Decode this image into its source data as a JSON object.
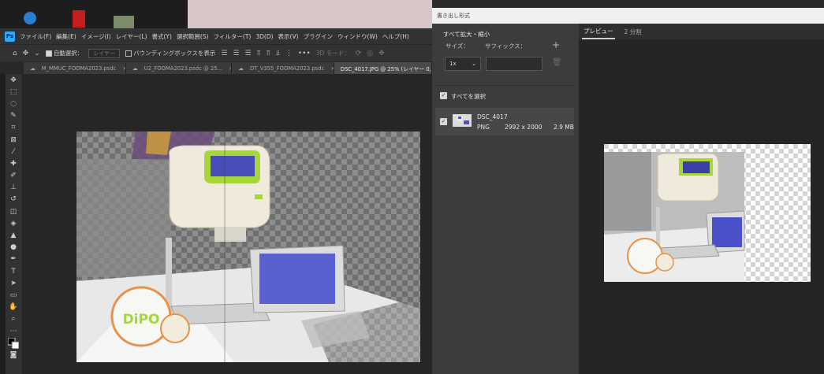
{
  "ps": {
    "logo": "Ps",
    "menu": [
      "ファイル(F)",
      "編集(E)",
      "イメージ(I)",
      "レイヤー(L)",
      "書式(Y)",
      "選択範囲(S)",
      "フィルター(T)",
      "3D(D)",
      "表示(V)",
      "プラグイン",
      "ウィンドウ(W)",
      "ヘルプ(H)"
    ],
    "options": {
      "auto_select_label": "自動選択：",
      "auto_select_value": "レイヤー",
      "bounding_box_label": "バウンディングボックスを表示",
      "mode_3d": "3D モード："
    },
    "tabs": [
      {
        "label": "M_MMUC_FOOMA2023.psdc",
        "active": false
      },
      {
        "label": "U2_FOOMA2023.psdc @ 25...",
        "active": false
      },
      {
        "label": "DT_V355_FOOMA2023.psdc",
        "active": false
      },
      {
        "label": "DSC_4017.JPG @ 25% (レイヤー 0, レイヤーマ",
        "active": true
      }
    ]
  },
  "dialog": {
    "title": "書き出し形式",
    "settings": {
      "scale_all_label": "すべて拡大・縮小",
      "size_label": "サイズ：",
      "suffix_label": "サフィックス：",
      "size_value": "1x",
      "select_all_label": "すべてを選択",
      "asset": {
        "name": "DSC_4017",
        "format": "PNG",
        "dimensions": "2992 x 2000",
        "filesize": "2.9 MB"
      }
    },
    "preview_tabs": [
      "プレビュー",
      "2 分割"
    ],
    "active_preview_tab": "プレビュー"
  },
  "image_text": {
    "badge": "DiPO"
  },
  "colors": {
    "ps_blue": "#31a8ff",
    "lime_accent": "#a6d63a",
    "badge_orange": "#e8914a",
    "screen_blue": "#4a50c8"
  }
}
